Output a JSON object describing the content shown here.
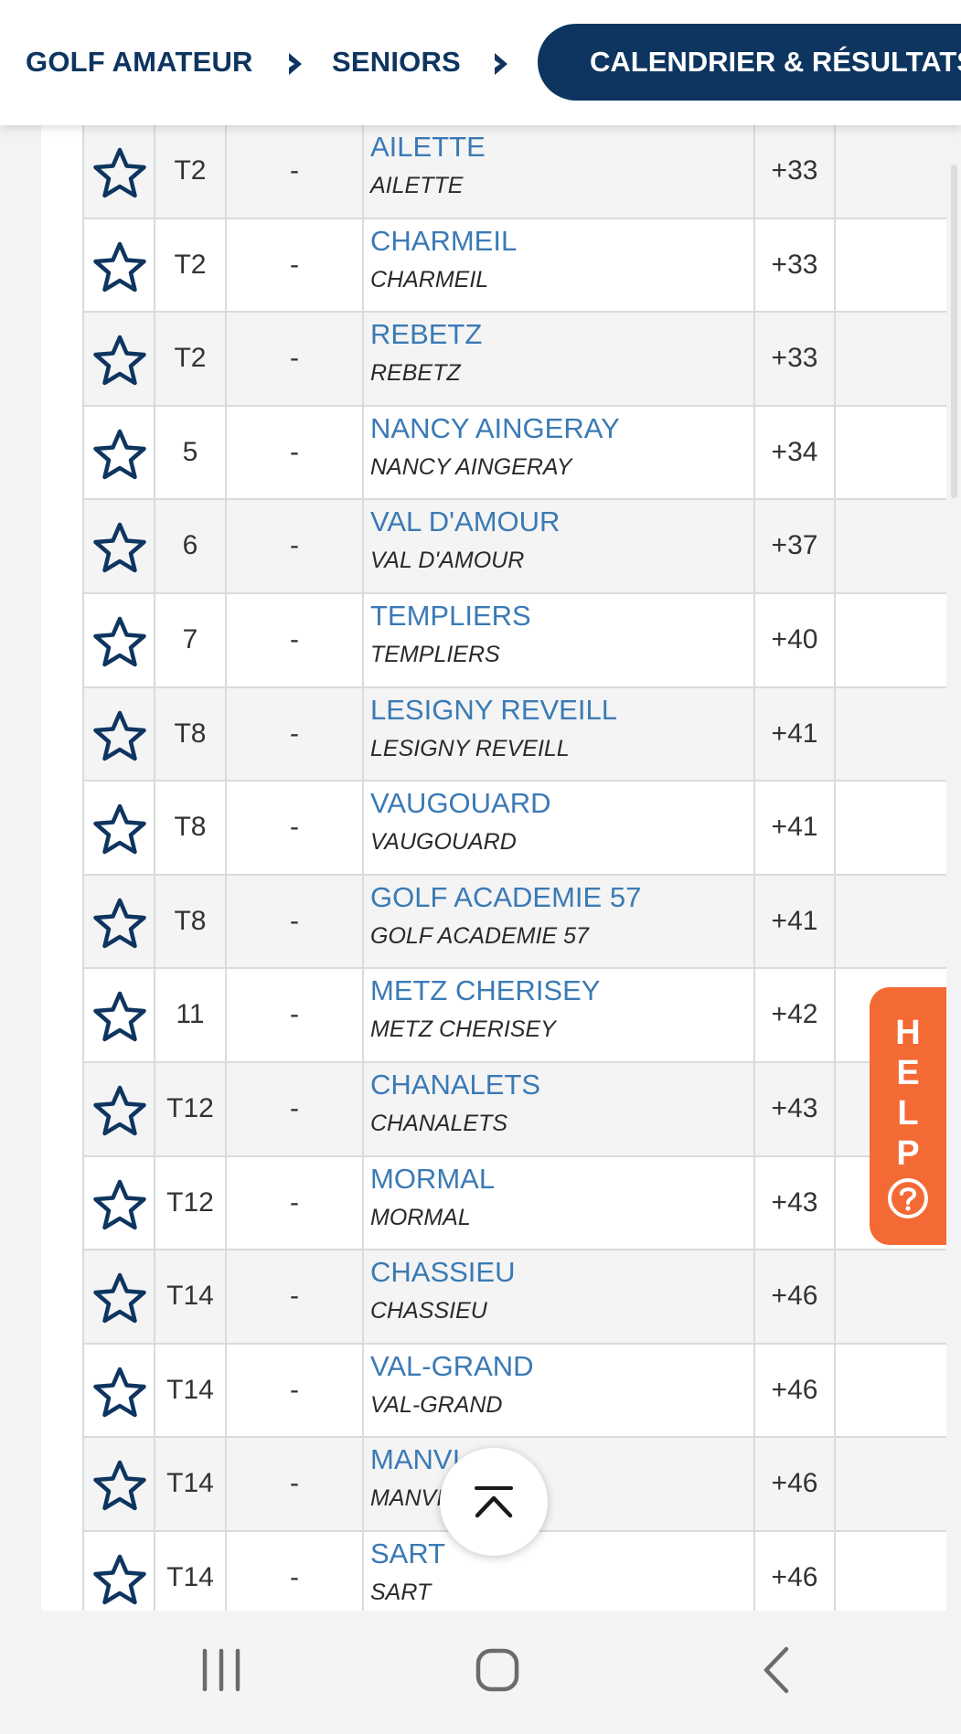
{
  "header": {
    "crumbs": [
      "GOLF AMATEUR",
      "SENIORS"
    ],
    "active_crumb": "CALENDRIER & RÉSULTATS"
  },
  "colors": {
    "brand_navy": "#0d3560",
    "link_blue": "#3a7ab5",
    "help_orange": "#f46a34"
  },
  "table": {
    "rows": [
      {
        "pos": "T2",
        "dash": "-",
        "name": "AILETTE",
        "club": "AILETTE",
        "score": "+33"
      },
      {
        "pos": "T2",
        "dash": "-",
        "name": "CHARMEIL",
        "club": "CHARMEIL",
        "score": "+33"
      },
      {
        "pos": "T2",
        "dash": "-",
        "name": "REBETZ",
        "club": "REBETZ",
        "score": "+33"
      },
      {
        "pos": "5",
        "dash": "-",
        "name": "NANCY AINGERAY",
        "club": "NANCY AINGERAY",
        "score": "+34"
      },
      {
        "pos": "6",
        "dash": "-",
        "name": "VAL D'AMOUR",
        "club": "VAL D'AMOUR",
        "score": "+37"
      },
      {
        "pos": "7",
        "dash": "-",
        "name": "TEMPLIERS",
        "club": "TEMPLIERS",
        "score": "+40"
      },
      {
        "pos": "T8",
        "dash": "-",
        "name": "LESIGNY REVEILL",
        "club": "LESIGNY REVEILL",
        "score": "+41"
      },
      {
        "pos": "T8",
        "dash": "-",
        "name": "VAUGOUARD",
        "club": "VAUGOUARD",
        "score": "+41"
      },
      {
        "pos": "T8",
        "dash": "-",
        "name": "GOLF ACADEMIE 57",
        "club": "GOLF ACADEMIE 57",
        "score": "+41"
      },
      {
        "pos": "11",
        "dash": "-",
        "name": "METZ CHERISEY",
        "club": "METZ CHERISEY",
        "score": "+42"
      },
      {
        "pos": "T12",
        "dash": "-",
        "name": "CHANALETS",
        "club": "CHANALETS",
        "score": "+43"
      },
      {
        "pos": "T12",
        "dash": "-",
        "name": "MORMAL",
        "club": "MORMAL",
        "score": "+43"
      },
      {
        "pos": "T14",
        "dash": "-",
        "name": "CHASSIEU",
        "club": "CHASSIEU",
        "score": "+46"
      },
      {
        "pos": "T14",
        "dash": "-",
        "name": "VAL-GRAND",
        "club": "VAL-GRAND",
        "score": "+46"
      },
      {
        "pos": "T14",
        "dash": "-",
        "name": "MANVI",
        "club": "MANVI",
        "score": "+46"
      },
      {
        "pos": "T14",
        "dash": "-",
        "name": "SART",
        "club": "SART",
        "score": "+46"
      }
    ]
  },
  "help": {
    "letters": [
      "H",
      "E",
      "L",
      "P"
    ],
    "icon": "question-circle-icon"
  },
  "scroll_top": {
    "icon": "chevron-up-icon"
  },
  "navbar": {
    "icons": [
      "recent-apps-icon",
      "home-icon",
      "back-icon"
    ]
  }
}
